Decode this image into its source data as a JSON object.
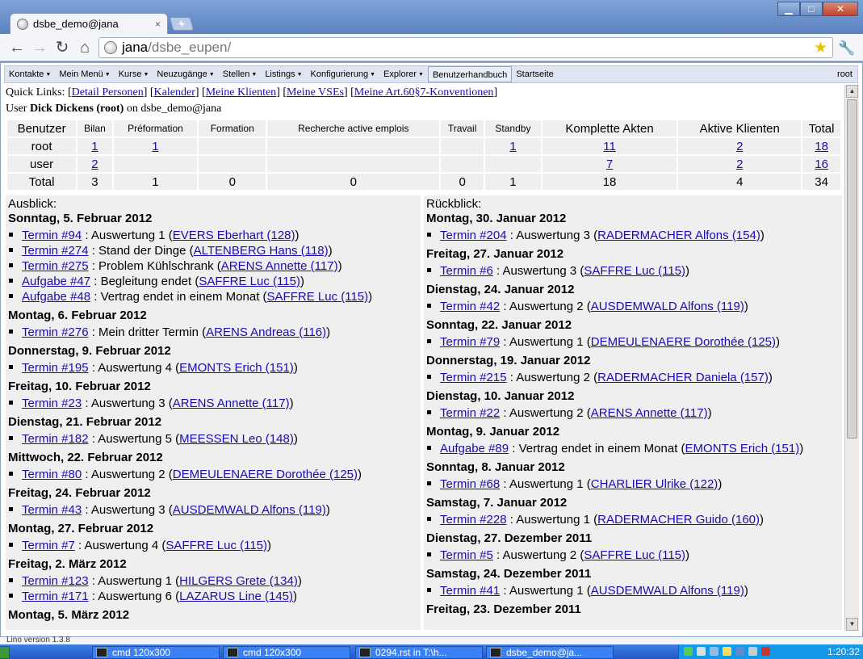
{
  "browser": {
    "tab_title": "dsbe_demo@jana",
    "tab_close": "×",
    "new_tab": "+",
    "url_host": "jana",
    "url_path": "/dsbe_eupen/",
    "win_minimize": "▁",
    "win_maximize": "□",
    "win_close": "✕"
  },
  "menu": {
    "items": [
      "Kontakte",
      "Mein Menü",
      "Kurse",
      "Neuzugänge",
      "Stellen",
      "Listings",
      "Konfigurierung",
      "Explorer"
    ],
    "help": "Benutzerhandbuch",
    "home": "Startseite",
    "user": "root"
  },
  "quicklinks": {
    "prefix": "Quick Links: ",
    "links": [
      "Detail Personen",
      "Kalender",
      "Meine Klienten",
      "Meine VSEs",
      "Meine Art.60§7-Konventionen"
    ]
  },
  "userline": {
    "prefix": "User ",
    "name": "Dick Dickens (root)",
    "suffix": " on dsbe_demo@jana"
  },
  "stats": {
    "headers": [
      "Benutzer",
      "Bilan",
      "Préformation",
      "Formation",
      "Recherche active emplois",
      "Travail",
      "Standby",
      "Komplette Akten",
      "Aktive Klienten",
      "Total"
    ],
    "rows": [
      [
        "root",
        "1",
        "1",
        "",
        "",
        "",
        "1",
        "11",
        "2",
        "18"
      ],
      [
        "user",
        "2",
        "",
        "",
        "",
        "",
        "",
        "7",
        "2",
        "16"
      ],
      [
        "Total",
        "3",
        "1",
        "0",
        "0",
        "0",
        "1",
        "18",
        "4",
        "34"
      ]
    ]
  },
  "ausblick": {
    "title": "Ausblick:",
    "days": [
      {
        "date": "Sonntag, 5. Februar 2012",
        "entries": [
          {
            "link": "Termin #94",
            "text": " : Auswertung 1 (",
            "person": "EVERS Eberhart (128)"
          },
          {
            "link": "Termin #274",
            "text": " : Stand der Dinge (",
            "person": "ALTENBERG Hans (118)"
          },
          {
            "link": "Termin #275",
            "text": " : Problem Kühlschrank (",
            "person": "ARENS Annette (117)"
          },
          {
            "link": "Aufgabe #47",
            "text": " : Begleitung endet (",
            "person": "SAFFRE Luc (115)"
          },
          {
            "link": "Aufgabe #48",
            "text": " : Vertrag endet in einem Monat (",
            "person": "SAFFRE Luc (115)"
          }
        ]
      },
      {
        "date": "Montag, 6. Februar 2012",
        "entries": [
          {
            "link": "Termin #276",
            "text": " : Mein dritter Termin (",
            "person": "ARENS Andreas (116)"
          }
        ]
      },
      {
        "date": "Donnerstag, 9. Februar 2012",
        "entries": [
          {
            "link": "Termin #195",
            "text": " : Auswertung 4 (",
            "person": "EMONTS Erich (151)"
          }
        ]
      },
      {
        "date": "Freitag, 10. Februar 2012",
        "entries": [
          {
            "link": "Termin #23",
            "text": " : Auswertung 3 (",
            "person": "ARENS Annette (117)"
          }
        ]
      },
      {
        "date": "Dienstag, 21. Februar 2012",
        "entries": [
          {
            "link": "Termin #182",
            "text": " : Auswertung 5 (",
            "person": "MEESSEN Leo (148)"
          }
        ]
      },
      {
        "date": "Mittwoch, 22. Februar 2012",
        "entries": [
          {
            "link": "Termin #80",
            "text": " : Auswertung 2 (",
            "person": "DEMEULENAERE Dorothée (125)"
          }
        ]
      },
      {
        "date": "Freitag, 24. Februar 2012",
        "entries": [
          {
            "link": "Termin #43",
            "text": " : Auswertung 3 (",
            "person": "AUSDEMWALD Alfons (119)"
          }
        ]
      },
      {
        "date": "Montag, 27. Februar 2012",
        "entries": [
          {
            "link": "Termin #7",
            "text": " : Auswertung 4 (",
            "person": "SAFFRE Luc (115)"
          }
        ]
      },
      {
        "date": "Freitag, 2. März 2012",
        "entries": [
          {
            "link": "Termin #123",
            "text": " : Auswertung 1 (",
            "person": "HILGERS Grete (134)"
          },
          {
            "link": "Termin #171",
            "text": " : Auswertung 6 (",
            "person": "LAZARUS Line (145)"
          }
        ]
      },
      {
        "date": "Montag, 5. März 2012",
        "entries": []
      }
    ]
  },
  "rueckblick": {
    "title": "Rückblick:",
    "days": [
      {
        "date": "Montag, 30. Januar 2012",
        "entries": [
          {
            "link": "Termin #204",
            "text": " : Auswertung 3 (",
            "person": "RADERMACHER Alfons (154)"
          }
        ]
      },
      {
        "date": "Freitag, 27. Januar 2012",
        "entries": [
          {
            "link": "Termin #6",
            "text": " : Auswertung 3 (",
            "person": "SAFFRE Luc (115)"
          }
        ]
      },
      {
        "date": "Dienstag, 24. Januar 2012",
        "entries": [
          {
            "link": "Termin #42",
            "text": " : Auswertung 2 (",
            "person": "AUSDEMWALD Alfons (119)"
          }
        ]
      },
      {
        "date": "Sonntag, 22. Januar 2012",
        "entries": [
          {
            "link": "Termin #79",
            "text": " : Auswertung 1 (",
            "person": "DEMEULENAERE Dorothée (125)"
          }
        ]
      },
      {
        "date": "Donnerstag, 19. Januar 2012",
        "entries": [
          {
            "link": "Termin #215",
            "text": " : Auswertung 2 (",
            "person": "RADERMACHER Daniela (157)"
          }
        ]
      },
      {
        "date": "Dienstag, 10. Januar 2012",
        "entries": [
          {
            "link": "Termin #22",
            "text": " : Auswertung 2 (",
            "person": "ARENS Annette (117)"
          }
        ]
      },
      {
        "date": "Montag, 9. Januar 2012",
        "entries": [
          {
            "link": "Aufgabe #89",
            "text": " : Vertrag endet in einem Monat (",
            "person": "EMONTS Erich (151)"
          }
        ]
      },
      {
        "date": "Sonntag, 8. Januar 2012",
        "entries": [
          {
            "link": "Termin #68",
            "text": " : Auswertung 1 (",
            "person": "CHARLIER Ulrike (122)"
          }
        ]
      },
      {
        "date": "Samstag, 7. Januar 2012",
        "entries": [
          {
            "link": "Termin #228",
            "text": " : Auswertung 1 (",
            "person": "RADERMACHER Guido (160)"
          }
        ]
      },
      {
        "date": "Dienstag, 27. Dezember 2011",
        "entries": [
          {
            "link": "Termin #5",
            "text": " : Auswertung 2 (",
            "person": "SAFFRE Luc (115)"
          }
        ]
      },
      {
        "date": "Samstag, 24. Dezember 2011",
        "entries": [
          {
            "link": "Termin #41",
            "text": " : Auswertung 1 (",
            "person": "AUSDEMWALD Alfons (119)"
          }
        ]
      },
      {
        "date": "Freitag, 23. Dezember 2011",
        "entries": []
      }
    ]
  },
  "status": "Lino version 1.3.8",
  "taskbar": {
    "tasks": [
      "cmd 120x300",
      "cmd 120x300",
      "0294.rst in T:\\h...",
      "dsbe_demo@ja..."
    ],
    "clock": "1:20:32"
  }
}
